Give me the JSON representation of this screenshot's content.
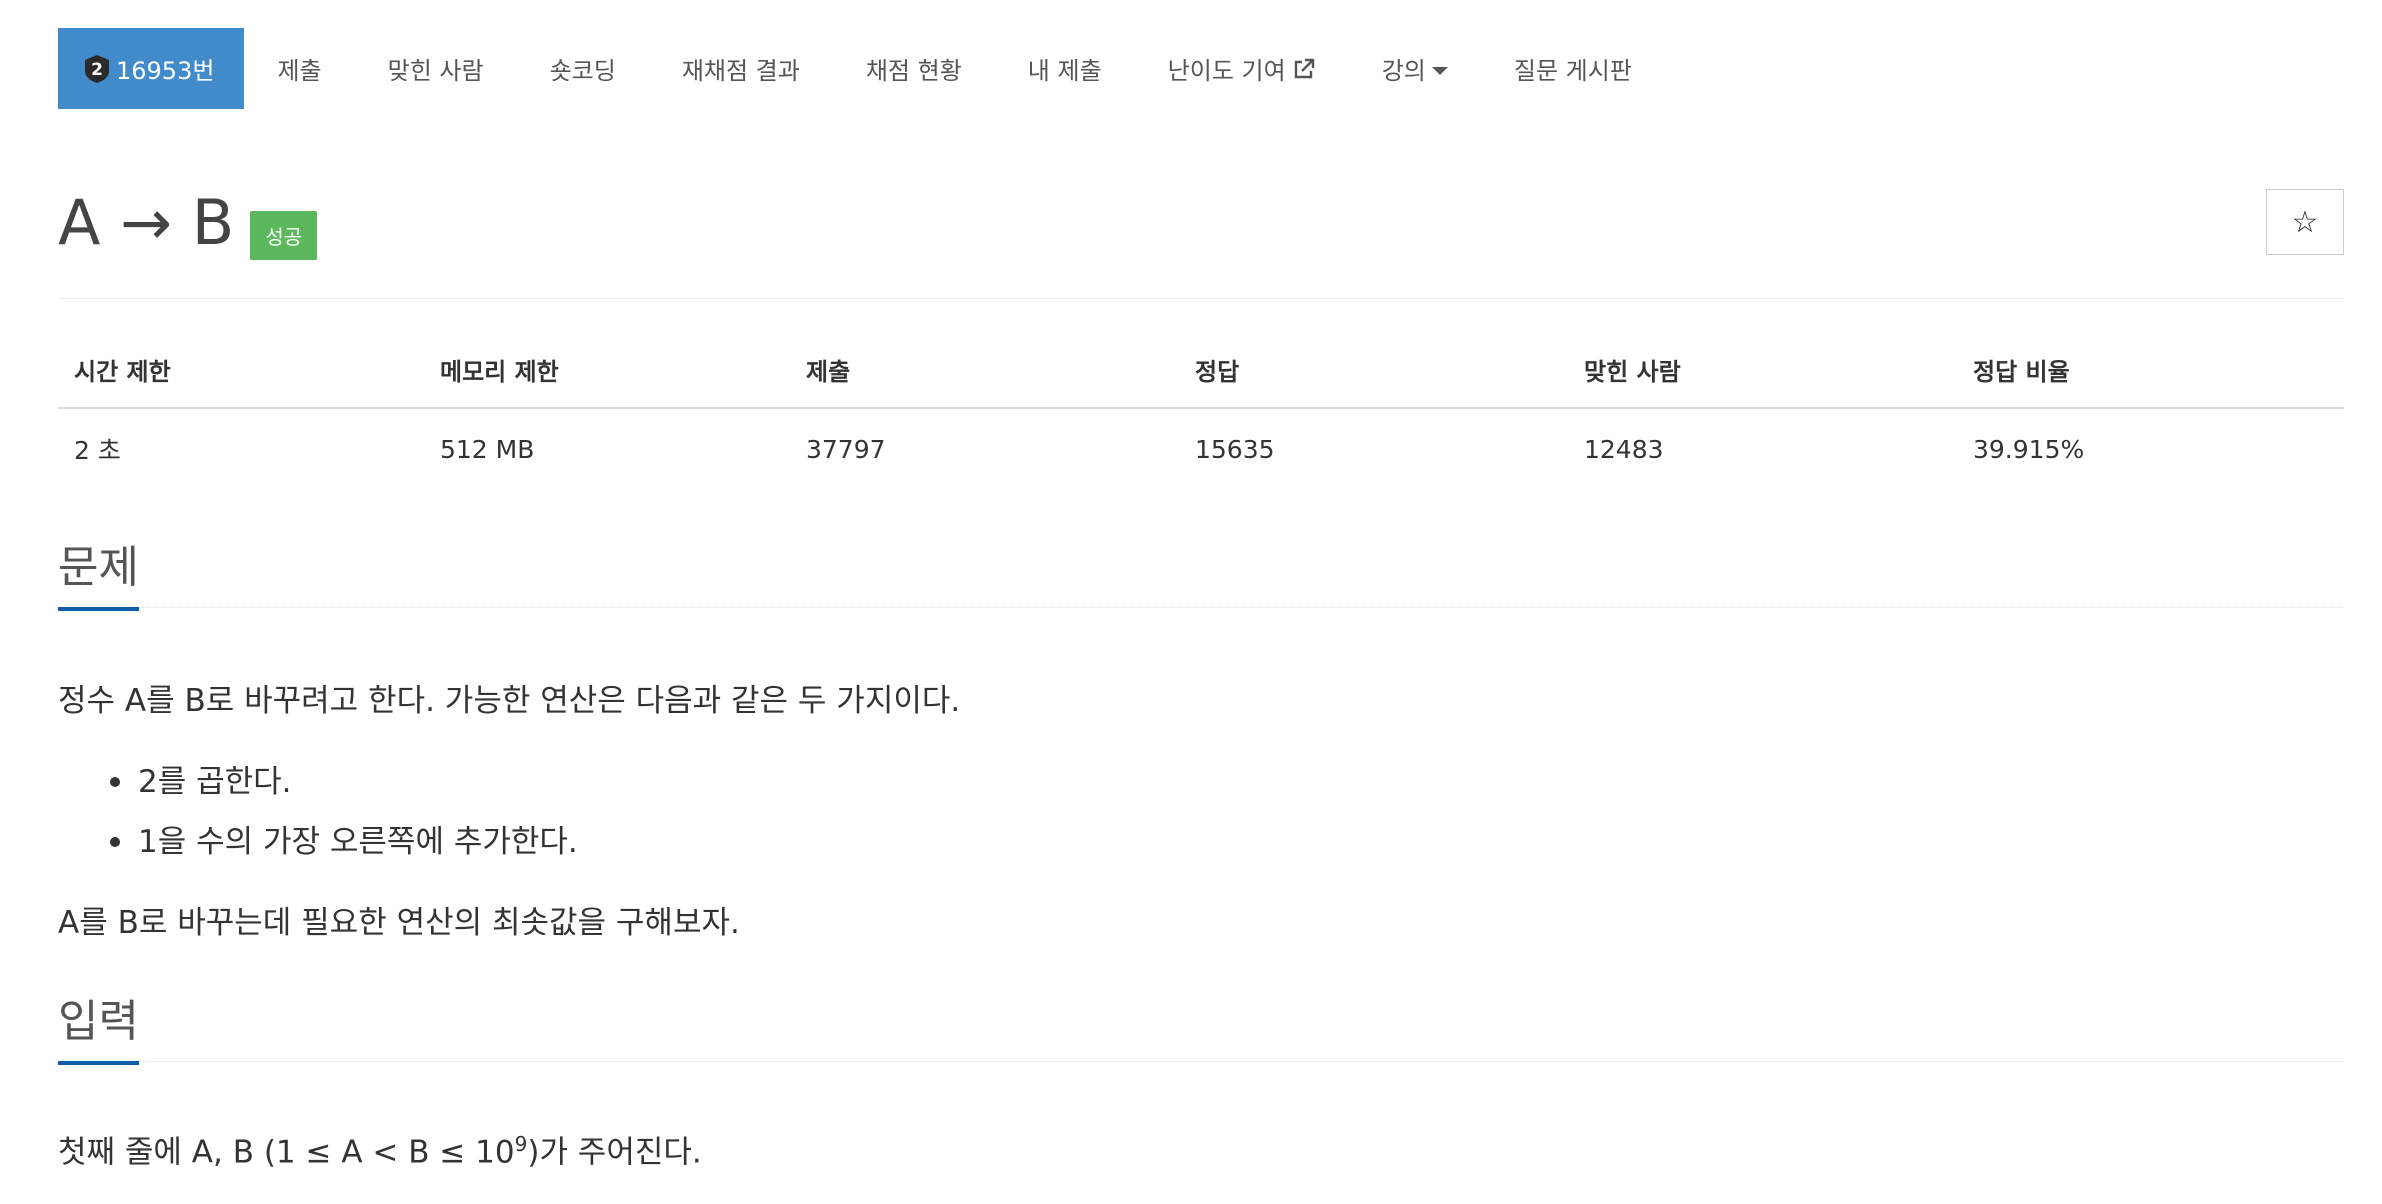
{
  "nav": {
    "problem_number": "16953번",
    "tier_badge_digit": "2",
    "items": [
      {
        "label": "제출"
      },
      {
        "label": "맞힌 사람"
      },
      {
        "label": "숏코딩"
      },
      {
        "label": "재채점 결과"
      },
      {
        "label": "채점 현황"
      },
      {
        "label": "내 제출"
      },
      {
        "label": "난이도 기여",
        "icon": "external-link-icon"
      },
      {
        "label": "강의",
        "icon": "caret-down-icon"
      },
      {
        "label": "질문 게시판"
      }
    ]
  },
  "problem": {
    "title": "A → B",
    "status_badge": "성공",
    "star_icon": "☆"
  },
  "info_table": {
    "headers": [
      "시간 제한",
      "메모리 제한",
      "제출",
      "정답",
      "맞힌 사람",
      "정답 비율"
    ],
    "values": [
      "2 초",
      "512 MB",
      "37797",
      "15635",
      "12483",
      "39.915%"
    ]
  },
  "sections": {
    "problem_heading": "문제",
    "problem_intro": "정수 A를 B로 바꾸려고 한다. 가능한 연산은 다음과 같은 두 가지이다.",
    "operations": [
      "2를 곱한다.",
      "1을 수의 가장 오른쪽에 추가한다."
    ],
    "problem_goal": "A를 B로 바꾸는데 필요한 연산의 최솟값을 구해보자.",
    "input_heading": "입력",
    "input_text_before": "첫째 줄에 A, B (1 ≤ A < B ≤ 10",
    "input_exponent": "9",
    "input_text_after": ")가 주어진다."
  },
  "colors": {
    "nav_active_bg": "#428bca",
    "badge_success": "#5cb85c",
    "section_underline": "#0f5ca8"
  }
}
